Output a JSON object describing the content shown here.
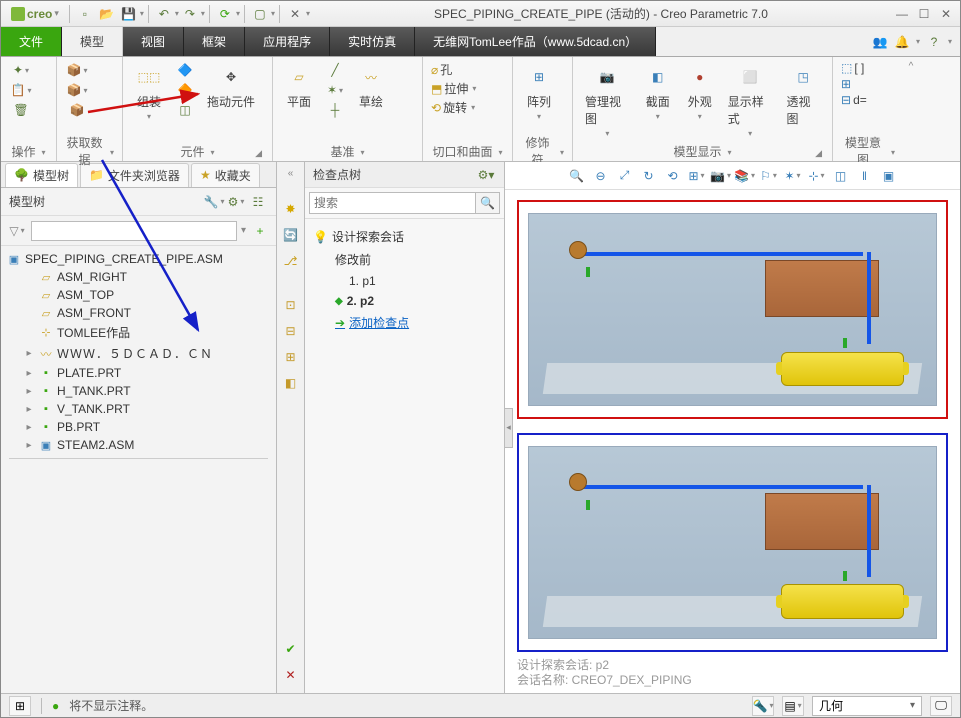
{
  "app": {
    "logo_text": "creo",
    "doc_title": "SPEC_PIPING_CREATE_PIPE (活动的) - Creo Parametric 7.0"
  },
  "menu": {
    "file": "文件",
    "model": "模型",
    "view": "视图",
    "frame": "框架",
    "app": "应用程序",
    "sim": "实时仿真",
    "author": "无维网TomLee作品（www.5dcad.cn）"
  },
  "ribbon": {
    "g1": "操作",
    "g2": "获取数据",
    "g3": "元件",
    "g4": "基准",
    "g5": "切口和曲面",
    "g6": "修饰符",
    "g7": "模型显示",
    "g8": "模型意图",
    "assemble": "组装",
    "drag": "拖动元件",
    "plane": "平面",
    "sketch": "草绘",
    "hole": "孔",
    "extrude": "拉伸",
    "revolve": "旋转",
    "array": "阵列",
    "mgview": "管理视图",
    "section": "截面",
    "appear": "外观",
    "dispstyle": "显示样式",
    "persp": "透视图",
    "de": "d="
  },
  "sidebar": {
    "tab1": "模型树",
    "tab2": "文件夹浏览器",
    "tab3": "收藏夹",
    "header": "模型树",
    "root": "SPEC_PIPING_CREATE_PIPE.ASM",
    "items": [
      "ASM_RIGHT",
      "ASM_TOP",
      "ASM_FRONT",
      "TOMLEE作品",
      "ＷＷＷ．５ＤＣＡＤ．ＣＮ",
      "PLATE.PRT",
      "H_TANK.PRT",
      "V_TANK.PRT",
      "PB.PRT",
      "STEAM2.ASM"
    ]
  },
  "checkpoint": {
    "header": "检查点树",
    "search_ph": "搜索",
    "root": "设计探索会话",
    "before": "修改前",
    "p1": "1. p1",
    "p2": "2. p2",
    "add": "添加检查点"
  },
  "status": {
    "msg": "将不显示注释。",
    "select_label": "几何",
    "view_line1": "设计探索会话: p2",
    "view_line2": "会话名称: CREO7_DEX_PIPING"
  },
  "icons": {
    "search": "🔍",
    "save": "💾",
    "undo": "↶",
    "redo": "↷",
    "newdoc": "▭",
    "open": "📂",
    "regen": "⟳",
    "window": "▢",
    "close": "✕",
    "min": "—",
    "max": "☐",
    "down": "▾",
    "funnel": "▽",
    "plus": "+",
    "settings": "⚙",
    "bulb": "💡",
    "pin": "📌",
    "star": "✦",
    "arrow_r": "➔"
  }
}
